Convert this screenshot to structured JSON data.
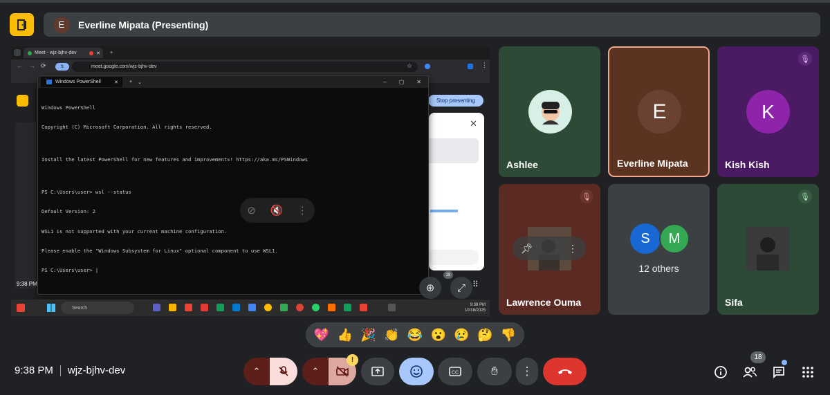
{
  "header": {
    "presenter_initial": "E",
    "presenter_title": "Everline Mipata (Presenting)"
  },
  "presented_screen": {
    "browser_tab": "Meet - wjz-bjhv-dev",
    "address": "meet.google.com/wjz-bjhv-dev",
    "stop_presenting": "Stop presenting",
    "powershell": {
      "tab_title": "Windows PowerShell",
      "lines": [
        "Windows PowerShell",
        "Copyright (C) Microsoft Corporation. All rights reserved.",
        "",
        "Install the latest PowerShell for new features and improvements! https://aka.ms/PSWindows",
        "",
        "PS C:\\Users\\user> wsl --status",
        "Default Version: 2",
        "WSL1 is not supported with your current machine configuration.",
        "Please enable the \"Windows Subsystem for Linux\" optional component to use WSL1.",
        "PS C:\\Users\\user> |"
      ]
    },
    "taskbar_search": "Search",
    "taskbar_time": "9:38 PM",
    "taskbar_date": "10/18/2025",
    "inner_clock": "9:38 PM",
    "inner_people_count": "18"
  },
  "participants": [
    {
      "name": "Ashlee",
      "bg": "#2d4a36",
      "muted": false
    },
    {
      "name": "Everline Mipata",
      "initial": "E",
      "bg": "#5c3220",
      "speaking": true
    },
    {
      "name": "Kish Kish",
      "initial": "K",
      "bg": "#4a1a63",
      "muted": true
    },
    {
      "name": "Lawrence Ouma",
      "bg": "#5a2a23",
      "muted": true
    },
    {
      "others_label": "12 others",
      "initial_s": "S",
      "initial_m": "M",
      "bg": "#3c4043"
    },
    {
      "name": "Sifa",
      "bg": "#2d4a36",
      "muted": true
    }
  ],
  "reactions": [
    "💖",
    "👍",
    "🎉",
    "👏",
    "😂",
    "😮",
    "😢",
    "🤔",
    "👎"
  ],
  "bottom": {
    "time": "9:38 PM",
    "meeting_code": "wjz-bjhv-dev",
    "people_count": "18",
    "camera_warning": "!"
  },
  "icons": {
    "chevron": "^",
    "mic_off": "mic-off",
    "cam_off": "videocam-off",
    "present": "present-to-all",
    "emoji": "emoji",
    "captions": "closed-caption",
    "hand": "raise-hand",
    "more": "more-vert",
    "end_call": "call-end",
    "info": "info",
    "people": "people",
    "chat": "chat",
    "activities": "apps"
  },
  "colors": {
    "accent_red": "#5c1f1a",
    "mic_off_bg": "#f9dedc",
    "emoji_active": "#a8c7fa",
    "end_call": "#dc362e"
  }
}
